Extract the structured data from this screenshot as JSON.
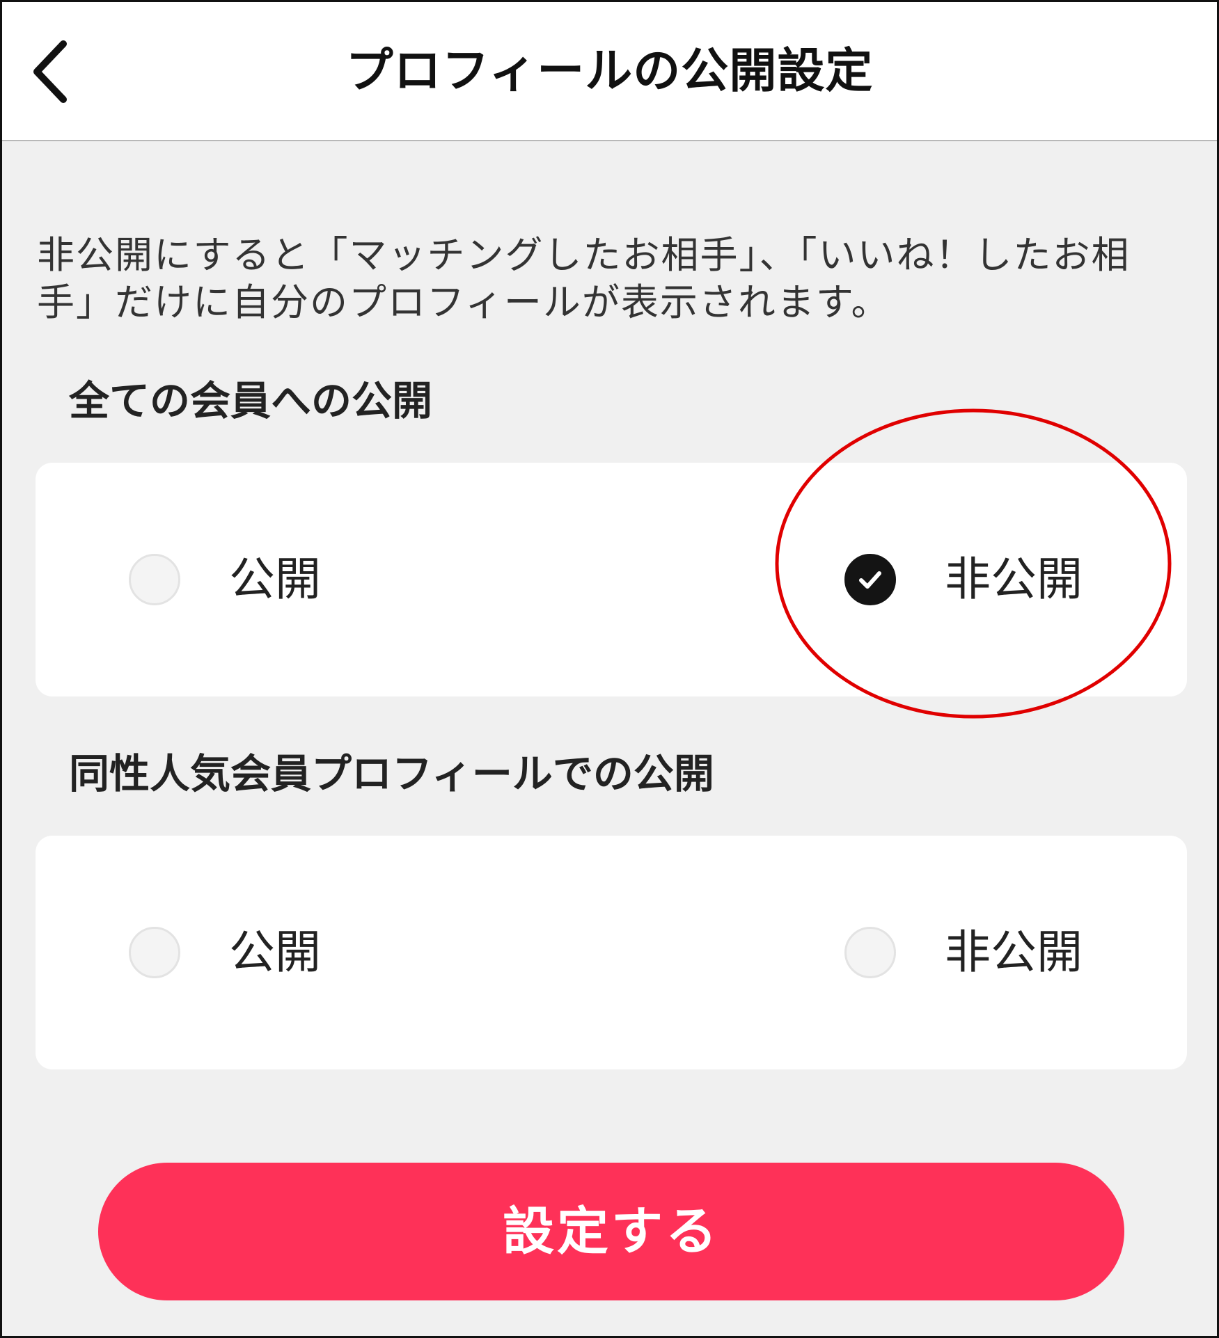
{
  "header": {
    "title": "プロフィールの公開設定",
    "back_icon": "chevron-left-icon"
  },
  "description": "非公開にすると「マッチングしたお相手」、「いいね！したお相手」だけに自分のプロフィールが表示されます。",
  "sections": [
    {
      "title": "全ての会員への公開",
      "options": [
        {
          "label": "公開",
          "selected": false
        },
        {
          "label": "非公開",
          "selected": true
        }
      ]
    },
    {
      "title": "同性人気会員プロフィールでの公開",
      "options": [
        {
          "label": "公開",
          "selected": false
        },
        {
          "label": "非公開",
          "selected": false
        }
      ]
    }
  ],
  "submit_label": "設定する",
  "colors": {
    "accent": "#fe3158",
    "annotation": "#e00000",
    "background": "#f0f0f0",
    "checked": "#141414"
  }
}
